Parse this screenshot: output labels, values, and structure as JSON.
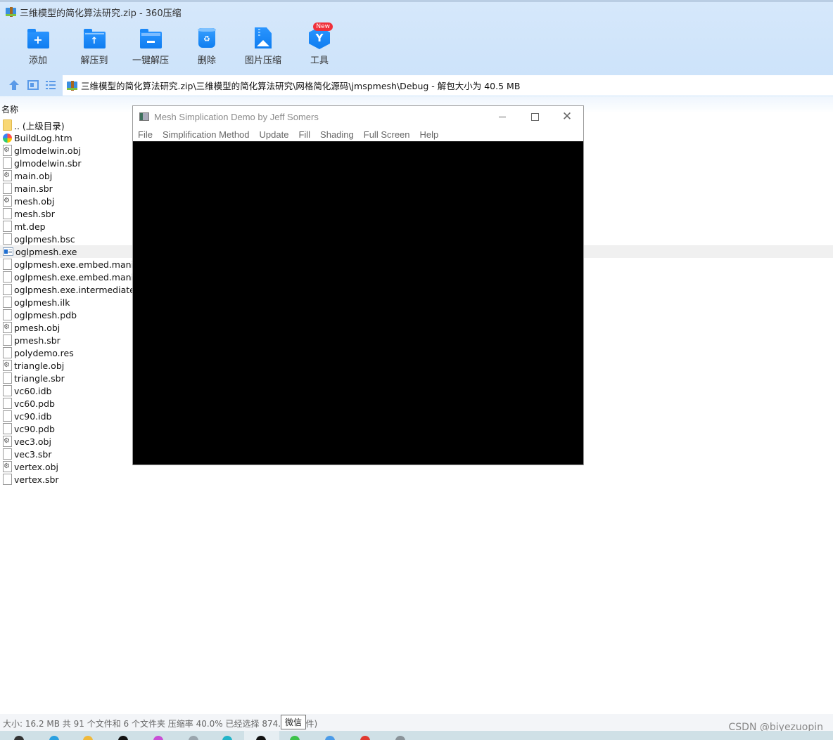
{
  "app": {
    "title": "三维模型的简化算法研究.zip - 360压缩"
  },
  "toolbar": {
    "items": [
      {
        "label": "添加",
        "icon": "add-folder-icon"
      },
      {
        "label": "解压到",
        "icon": "extract-to-folder-icon"
      },
      {
        "label": "一键解压",
        "icon": "one-click-extract-icon"
      },
      {
        "label": "删除",
        "icon": "recycle-bin-icon"
      },
      {
        "label": "图片压缩",
        "icon": "image-compress-icon"
      },
      {
        "label": "工具",
        "icon": "tools-hex-icon",
        "badge": "New"
      }
    ],
    "plus_glyph": "+",
    "up_glyph": "↑",
    "recycle_glyph": "♻",
    "tools_glyph": "Y"
  },
  "nav": {
    "path": "三维模型的简化算法研究.zip\\三维模型的简化算法研究\\网格简化源码\\jmspmesh\\Debug - 解包大小为 40.5 MB"
  },
  "list": {
    "column_name": "名称",
    "selected_index": 10,
    "files": [
      {
        "name": ".. (上级目录)",
        "type": "folder-up"
      },
      {
        "name": "BuildLog.htm",
        "type": "htm"
      },
      {
        "name": "glmodelwin.obj",
        "type": "obj"
      },
      {
        "name": "glmodelwin.sbr",
        "type": "doc"
      },
      {
        "name": "main.obj",
        "type": "obj"
      },
      {
        "name": "main.sbr",
        "type": "doc"
      },
      {
        "name": "mesh.obj",
        "type": "obj"
      },
      {
        "name": "mesh.sbr",
        "type": "doc"
      },
      {
        "name": "mt.dep",
        "type": "doc"
      },
      {
        "name": "oglpmesh.bsc",
        "type": "doc"
      },
      {
        "name": "oglpmesh.exe",
        "type": "exe"
      },
      {
        "name": "oglpmesh.exe.embed.manife",
        "type": "doc"
      },
      {
        "name": "oglpmesh.exe.embed.manife",
        "type": "doc"
      },
      {
        "name": "oglpmesh.exe.intermediate.m",
        "type": "doc"
      },
      {
        "name": "oglpmesh.ilk",
        "type": "doc"
      },
      {
        "name": "oglpmesh.pdb",
        "type": "doc"
      },
      {
        "name": "pmesh.obj",
        "type": "obj"
      },
      {
        "name": "pmesh.sbr",
        "type": "doc"
      },
      {
        "name": "polydemo.res",
        "type": "doc"
      },
      {
        "name": "triangle.obj",
        "type": "obj"
      },
      {
        "name": "triangle.sbr",
        "type": "doc"
      },
      {
        "name": "vc60.idb",
        "type": "doc"
      },
      {
        "name": "vc60.pdb",
        "type": "doc"
      },
      {
        "name": "vc90.idb",
        "type": "doc"
      },
      {
        "name": "vc90.pdb",
        "type": "doc"
      },
      {
        "name": "vec3.obj",
        "type": "obj"
      },
      {
        "name": "vec3.sbr",
        "type": "doc"
      },
      {
        "name": "vertex.obj",
        "type": "obj"
      },
      {
        "name": "vertex.sbr",
        "type": "doc"
      }
    ]
  },
  "status": {
    "text": "大小: 16.2 MB 共 91 个文件和 6 个文件夹 压缩率 40.0% 已经选择 874.5           个文件)",
    "tooltip": "微信"
  },
  "watermark": "CSDN @biyezuopin",
  "mesh_window": {
    "title": "Mesh Simplication Demo by Jeff Somers",
    "close_glyph": "✕",
    "menu": [
      "File",
      "Simplification Method",
      "Update",
      "Fill",
      "Shading",
      "Full Screen",
      "Help"
    ]
  },
  "taskbar": {
    "icons": [
      "start-icon",
      "edge-icon",
      "file-explorer-icon",
      "qq-icon",
      "color-app-icon",
      "notepad-icon",
      "browser-icon",
      "qq-active-icon",
      "wechat-icon",
      "folder-icon",
      "office-icon",
      "window-icon"
    ],
    "colors": [
      "#333333",
      "#2aa0e0",
      "#f0b93a",
      "#111111",
      "#c94fd6",
      "#9aa5ad",
      "#22b4c8",
      "#111111",
      "#3cc24a",
      "#4a9be8",
      "#e03a30",
      "#8a9399"
    ]
  }
}
